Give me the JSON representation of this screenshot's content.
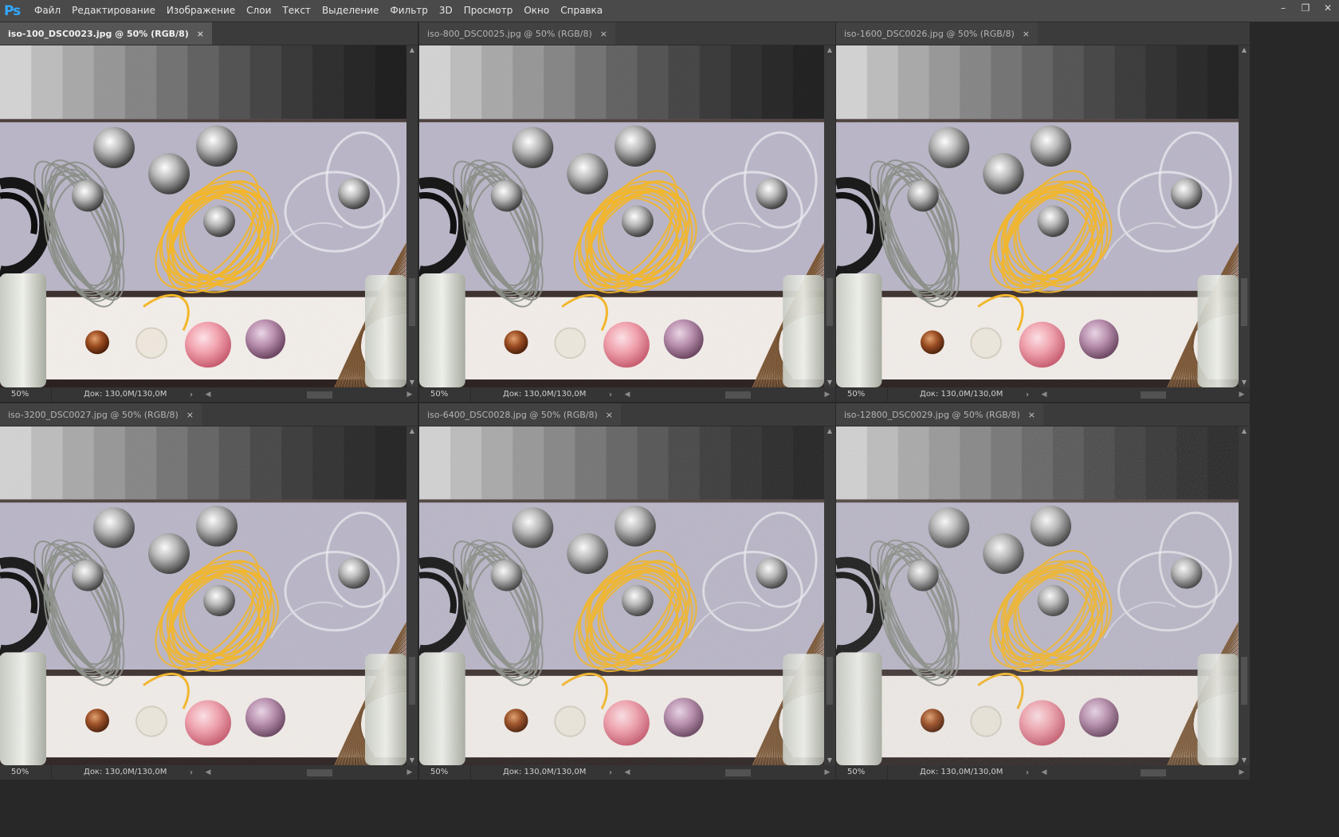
{
  "app": {
    "logo": "Ps"
  },
  "menu": [
    "Файл",
    "Редактирование",
    "Изображение",
    "Слои",
    "Текст",
    "Выделение",
    "Фильтр",
    "3D",
    "Просмотр",
    "Окно",
    "Справка"
  ],
  "window_controls": {
    "minimize": "–",
    "restore": "❐",
    "close": "✕"
  },
  "documents": [
    {
      "tab": "iso-100_DSC0023.jpg @ 50% (RGB/8)",
      "zoom": "50%",
      "info": "Док: 130,0M/130,0M",
      "active": true
    },
    {
      "tab": "iso-800_DSC0025.jpg @ 50% (RGB/8)",
      "zoom": "50%",
      "info": "Док: 130,0M/130,0M",
      "active": false
    },
    {
      "tab": "iso-1600_DSC0026.jpg @ 50% (RGB/8)",
      "zoom": "50%",
      "info": "Док: 130,0M/130,0M",
      "active": false
    },
    {
      "tab": "iso-3200_DSC0027.jpg @ 50% (RGB/8)",
      "zoom": "50%",
      "info": "Док: 130,0M/130,0M",
      "active": false
    },
    {
      "tab": "iso-6400_DSC0028.jpg @ 50% (RGB/8)",
      "zoom": "50%",
      "info": "Док: 130,0M/130,0M",
      "active": false
    },
    {
      "tab": "iso-12800_DSC0029.jpg @ 50% (RGB/8)",
      "zoom": "50%",
      "info": "Док: 130,0M/130,0M",
      "active": false
    }
  ],
  "tab_close_glyph": "×",
  "status_more_glyph": "›",
  "colors": {
    "ps_blue": "#31a8ff",
    "yarn": "#f0a820",
    "background_purple": "#b8b4c6"
  }
}
